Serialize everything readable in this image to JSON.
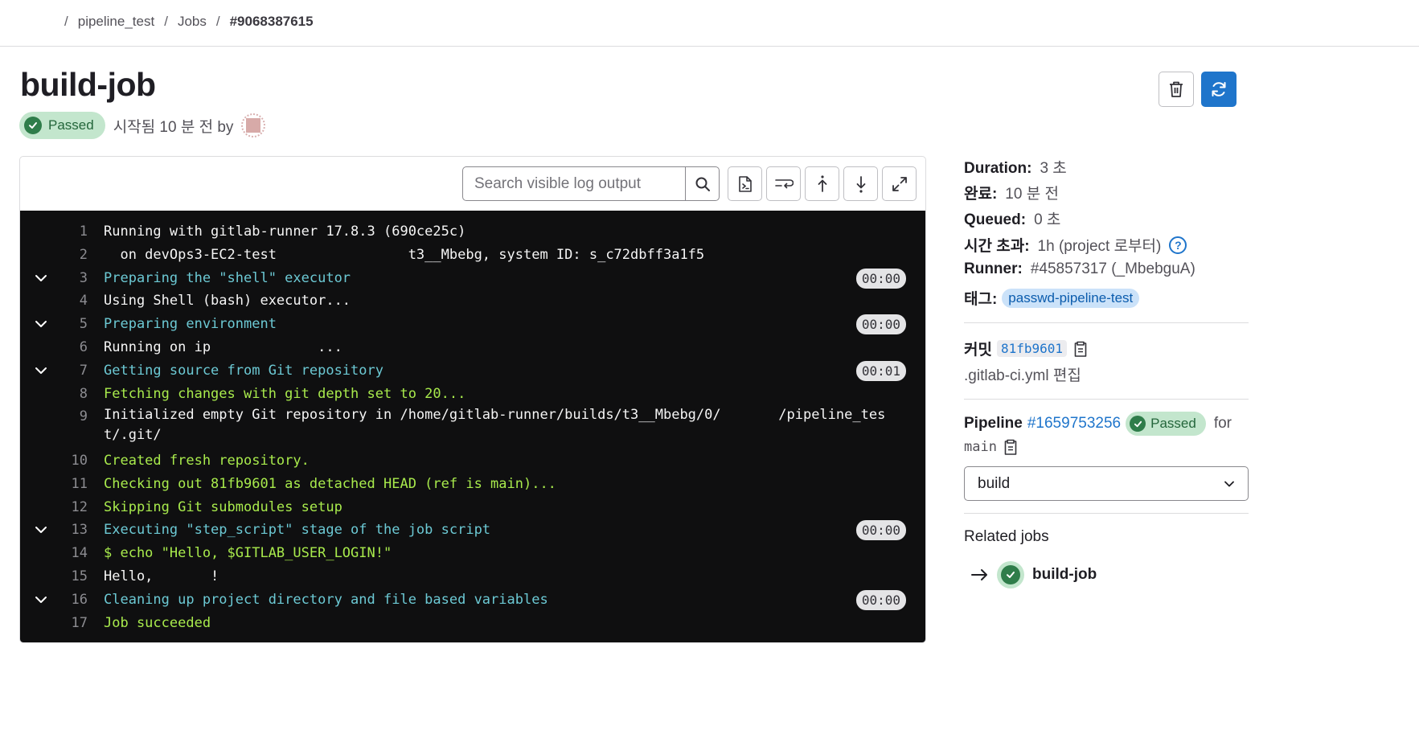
{
  "breadcrumb": {
    "items": [
      "pipeline_test",
      "Jobs",
      "#9068387615"
    ],
    "separator": "/"
  },
  "job": {
    "title": "build-job",
    "status": "Passed",
    "started_text": "시작됨 10 분 전 by"
  },
  "actions": {
    "delete_icon": "trash-icon",
    "retry_icon": "retry-icon"
  },
  "log_toolbar": {
    "search_placeholder": "Search visible log output",
    "buttons": [
      "raw-log-icon",
      "wrap-text-icon",
      "scroll-top-icon",
      "scroll-bottom-icon",
      "fullscreen-icon"
    ]
  },
  "log": [
    {
      "n": "1",
      "text": "Running with gitlab-runner 17.8.3 (690ce25c)",
      "style": "white",
      "section": false,
      "duration": ""
    },
    {
      "n": "2",
      "text": "  on devOps3-EC2-test                t3__Mbebg, system ID: s_c72dbff3a1f5",
      "style": "white",
      "section": false,
      "duration": ""
    },
    {
      "n": "3",
      "text": "Preparing the \"shell\" executor",
      "style": "cyan",
      "section": true,
      "duration": "00:00"
    },
    {
      "n": "4",
      "text": "Using Shell (bash) executor...",
      "style": "white",
      "section": false,
      "duration": ""
    },
    {
      "n": "5",
      "text": "Preparing environment",
      "style": "cyan",
      "section": true,
      "duration": "00:00"
    },
    {
      "n": "6",
      "text": "Running on ip             ...",
      "style": "white",
      "section": false,
      "duration": ""
    },
    {
      "n": "7",
      "text": "Getting source from Git repository",
      "style": "cyan",
      "section": true,
      "duration": "00:01"
    },
    {
      "n": "8",
      "text": "Fetching changes with git depth set to 20...",
      "style": "green",
      "section": false,
      "duration": ""
    },
    {
      "n": "9",
      "text": "Initialized empty Git repository in /home/gitlab-runner/builds/t3__Mbebg/0/       /pipeline_tes\nt/.git/",
      "style": "white",
      "section": false,
      "duration": ""
    },
    {
      "n": "10",
      "text": "Created fresh repository.",
      "style": "green",
      "section": false,
      "duration": ""
    },
    {
      "n": "11",
      "text": "Checking out 81fb9601 as detached HEAD (ref is main)...",
      "style": "green",
      "section": false,
      "duration": ""
    },
    {
      "n": "12",
      "text": "Skipping Git submodules setup",
      "style": "green",
      "section": false,
      "duration": ""
    },
    {
      "n": "13",
      "text": "Executing \"step_script\" stage of the job script",
      "style": "cyan",
      "section": true,
      "duration": "00:00"
    },
    {
      "n": "14",
      "text": "$ echo \"Hello, $GITLAB_USER_LOGIN!\"",
      "style": "green",
      "section": false,
      "duration": ""
    },
    {
      "n": "15",
      "text": "Hello,       !",
      "style": "white",
      "section": false,
      "duration": ""
    },
    {
      "n": "16",
      "text": "Cleaning up project directory and file based variables",
      "style": "cyan",
      "section": true,
      "duration": "00:00"
    },
    {
      "n": "17",
      "text": "Job succeeded",
      "style": "green",
      "section": false,
      "duration": ""
    }
  ],
  "sidebar": {
    "duration_label": "Duration:",
    "duration_value": "3 초",
    "finished_label": "완료:",
    "finished_value": "10 분 전",
    "queued_label": "Queued:",
    "queued_value": "0 초",
    "timeout_label": "시간 초과:",
    "timeout_value": "1h (project 로부터)",
    "runner_label": "Runner:",
    "runner_value": "#45857317 (_MbebguA)",
    "tags_label": "태그:",
    "tag": "passwd-pipeline-test",
    "commit_label": "커밋",
    "commit_sha": "81fb9601",
    "ci_file": ".gitlab-ci.yml 편집",
    "pipeline_label": "Pipeline",
    "pipeline_id": "#1659753256",
    "pipeline_status": "Passed",
    "for_text": "for",
    "ref": "main",
    "stage_select": "build",
    "related_title": "Related jobs",
    "related_job": "build-job"
  },
  "colors": {
    "success": "#2f7d4a",
    "primary": "#1f75cb",
    "log_bg": "#0f0f10"
  }
}
